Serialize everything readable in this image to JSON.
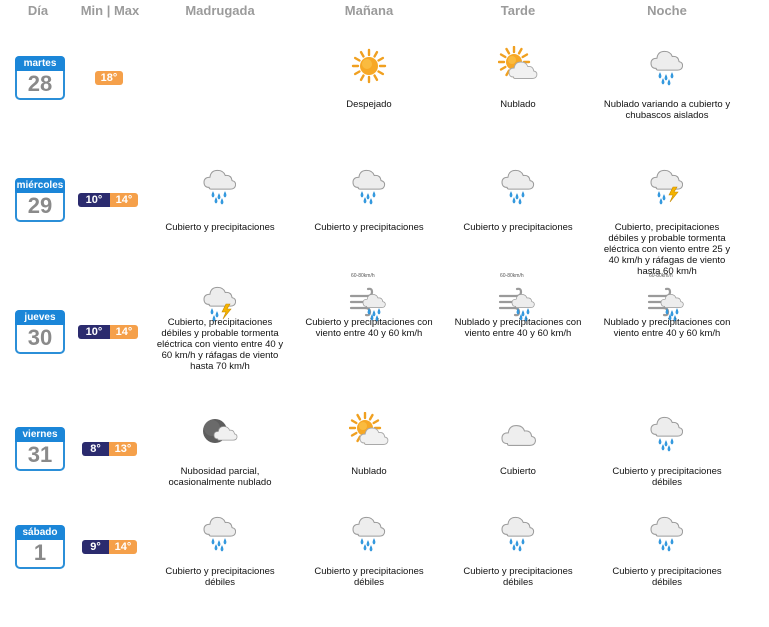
{
  "headers": {
    "dia": "Día",
    "minmax": "Min | Max",
    "madrugada": "Madrugada",
    "manana": "Mañana",
    "tarde": "Tarde",
    "noche": "Noche"
  },
  "days": [
    {
      "name": "martes",
      "num": "28",
      "min": "",
      "max": "18°",
      "periods": [
        {
          "icon": "",
          "text": ""
        },
        {
          "icon": "sun-icon",
          "text": "Despejado"
        },
        {
          "icon": "sun-cloud-icon",
          "text": "Nublado"
        },
        {
          "icon": "cloud-rain-icon",
          "text": "Nublado variando a cubierto y chubascos aislados"
        }
      ]
    },
    {
      "name": "miércoles",
      "num": "29",
      "min": "10°",
      "max": "14°",
      "periods": [
        {
          "icon": "cloud-rain-icon",
          "text": "Cubierto y precipitaciones"
        },
        {
          "icon": "cloud-rain-icon",
          "text": "Cubierto y precipitaciones"
        },
        {
          "icon": "cloud-rain-icon",
          "text": "Cubierto y precipitaciones"
        },
        {
          "icon": "cloud-storm-icon",
          "text": "Cubierto, precipitaciones débiles y probable tormenta eléctrica con viento entre 25 y 40 km/h y ráfagas de viento hasta 60 km/h"
        }
      ]
    },
    {
      "name": "jueves",
      "num": "30",
      "min": "10°",
      "max": "14°",
      "periods": [
        {
          "icon": "cloud-storm-icon",
          "text": "Cubierto, precipitaciones débiles y probable tormenta eléctrica con viento entre 40 y 60 km/h y ráfagas de viento hasta 70 km/h"
        },
        {
          "icon": "wind-rain-icon",
          "text": "Cubierto y precipitaciones con viento entre 40 y 60 km/h"
        },
        {
          "icon": "wind-storm-icon",
          "text": "Nublado y precipitaciones con viento entre 40 y 60 km/h"
        },
        {
          "icon": "wind-rain-icon",
          "text": "Nublado y precipitaciones con viento entre 40 y 60 km/h"
        }
      ]
    },
    {
      "name": "viernes",
      "num": "31",
      "min": "8°",
      "max": "13°",
      "periods": [
        {
          "icon": "moon-cloud-icon",
          "text": "Nubosidad parcial, ocasionalmente nublado"
        },
        {
          "icon": "sun-cloud-icon",
          "text": "Nublado"
        },
        {
          "icon": "cloud-icon",
          "text": "Cubierto"
        },
        {
          "icon": "cloud-rain-icon",
          "text": "Cubierto y precipitaciones débiles"
        }
      ]
    },
    {
      "name": "sábado",
      "num": "1",
      "min": "9°",
      "max": "14°",
      "periods": [
        {
          "icon": "cloud-rain-icon",
          "text": "Cubierto y precipitaciones débiles"
        },
        {
          "icon": "cloud-rain-icon",
          "text": "Cubierto y precipitaciones débiles"
        },
        {
          "icon": "cloud-rain-icon",
          "text": "Cubierto y precipitaciones débiles"
        },
        {
          "icon": "cloud-rain-icon",
          "text": "Cubierto y precipitaciones débiles"
        }
      ]
    }
  ],
  "wind_label": "60-80km/h",
  "colors": {
    "calendar_blue": "#1b86d8",
    "min_bg": "#2b2b6e",
    "max_bg": "#f5a04a",
    "header_gray": "#9b9b9b"
  }
}
